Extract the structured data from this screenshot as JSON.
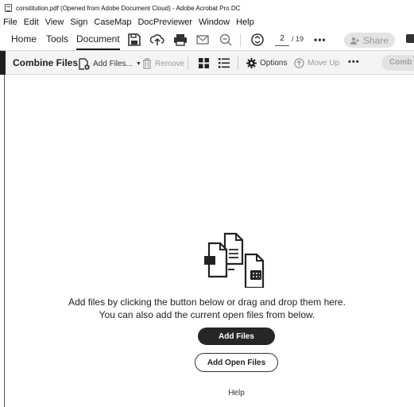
{
  "window": {
    "title": "constitution.pdf (Opened from Adobe Document Cloud) - Adobe Acrobat Pro DC"
  },
  "menu": [
    "File",
    "Edit",
    "View",
    "Sign",
    "CaseMap",
    "DocPreviewer",
    "Window",
    "Help"
  ],
  "toolbar": {
    "tabs": {
      "home": "Home",
      "tools": "Tools",
      "document": "Document"
    },
    "page_current": "2",
    "page_total": "/ 19",
    "more": "•••",
    "share": "Share",
    "icons": [
      "save-icon",
      "upload-icon",
      "print-icon",
      "email-icon",
      "zoom-out-icon",
      "page-navigation-icon",
      "more-icon",
      "comment-icon"
    ]
  },
  "subtoolbar": {
    "title": "Combine Files",
    "add_files": "Add Files...",
    "remove": "Remove",
    "options": "Options",
    "move_up": "Move Up",
    "more": "•••",
    "combine": "Comb"
  },
  "main": {
    "instruction_line1": "Add files by clicking the button below or drag and drop them here.",
    "instruction_line2": "You can also add the current open files from below.",
    "add_files_button": "Add Files",
    "add_open_files_button": "Add Open Files",
    "help": "Help"
  },
  "colors": {
    "accent_dark": "#262626",
    "toolbar_bg": "#f4f4f4",
    "disabled_text": "#9a9a9a"
  }
}
